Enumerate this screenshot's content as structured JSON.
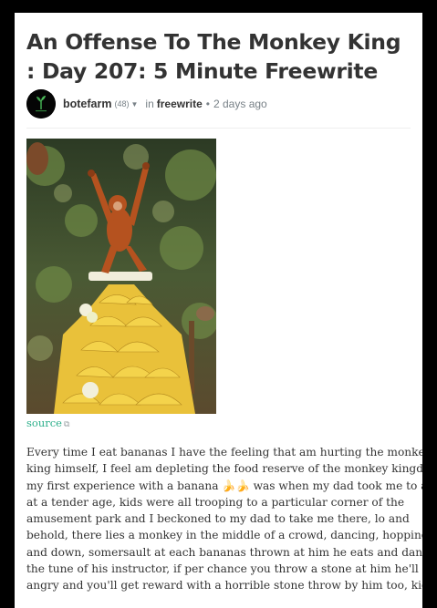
{
  "post": {
    "title": "An Offense To The Monkey King : Day 207: 5 Minute Freewrite",
    "author": "botefarm",
    "reputation": "(48)",
    "in_label": "in",
    "community": "freewrite",
    "separator": "•",
    "time": "2 days ago",
    "source_label": "source",
    "body_lines": [
      "Every time I eat bananas I have the feeling that am hurting the monkey",
      "king himself, I feel am depleting the food reserve of the monkey kingdom,",
      "my first experience with a banana 🍌🍌 was when my dad took me to a zoo",
      "at a tender age, kids were all trooping to a particular corner of the",
      "amusement park and I beckoned to my dad to take me there, lo and",
      "behold, there lies a monkey in the middle of a crowd, dancing, hopping up",
      "and down, somersault at each bananas thrown at him he eats and dance to",
      "the tune of his instructor, if per chance you throw a stone at him he'll get",
      "angry and you'll get reward with a horrible stone throw by him too, kids"
    ]
  },
  "icons": {
    "chevron": "chevron-down-icon",
    "external": "external-link-icon",
    "avatar": "avatar-plant-logo"
  },
  "colors": {
    "background": "#000000",
    "card": "#ffffff",
    "link": "#2baf8a",
    "text": "#333333",
    "muted": "#788187"
  }
}
